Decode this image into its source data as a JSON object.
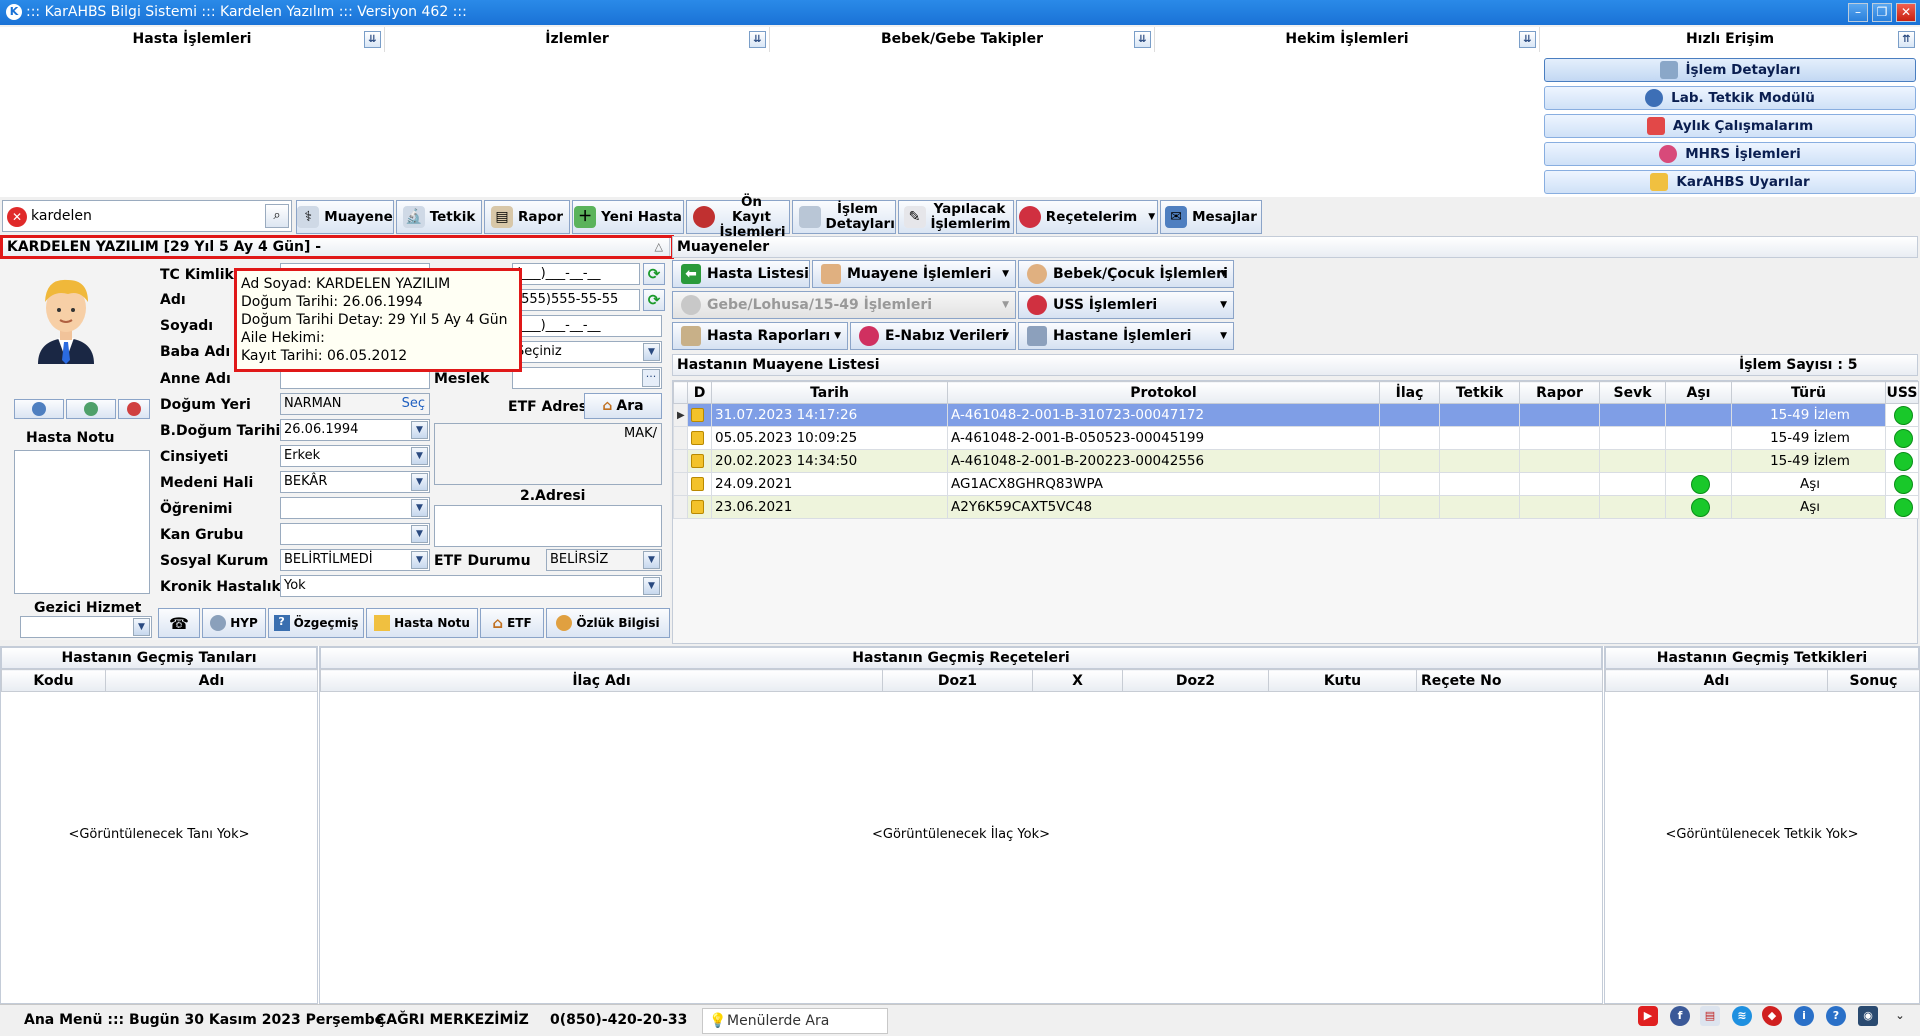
{
  "window": {
    "title": "::: KarAHBS Bilgi Sistemi ::: Kardelen Yazılım ::: Versiyon 462 :::"
  },
  "menu_headers": [
    "Hasta İşlemleri",
    "İzlemler",
    "Bebek/Gebe Takipler",
    "Hekim İşlemleri",
    "Hızlı Erişim"
  ],
  "quick_access": [
    "İşlem Detayları",
    "Lab. Tetkik Modülü",
    "Aylık Çalışmalarım",
    "MHRS İşlemleri",
    "KarAHBS Uyarılar"
  ],
  "search": {
    "value": "kardelen"
  },
  "toolbar": [
    "Muayene",
    "Tetkik",
    "Rapor",
    "Yeni Hasta",
    "Ön Kayıt İşlemleri",
    "İşlem Detayları",
    "Yapılacak İşlemlerim",
    "Reçetelerim",
    "Mesajlar"
  ],
  "patient": {
    "header": "KARDELEN YAZILIM  [29 Yıl  5 Ay  4 Gün] - ",
    "note_label": "Hasta Notu",
    "gezici_label": "Gezici Hizmet",
    "tooltip": [
      "Ad Soyad: KARDELEN YAZILIM",
      "Doğum Tarihi: 26.06.1994",
      "Doğum Tarihi Detay: 29 Yıl  5 Ay  4 Gün",
      "Aile Hekimi:",
      "Kayıt Tarihi: 06.05.2012"
    ],
    "labels": {
      "tc": "TC Kimlik N",
      "adi": "Adı",
      "soyadi": "Soyadı",
      "baba": "Baba Adı",
      "anne": "Anne Adı",
      "dogum_yeri": "Doğum Yeri",
      "b_dogum": "B.Doğum Tarihi",
      "cinsiyet": "Cinsiyeti",
      "medeni": "Medeni Hali",
      "ogrenim": "Öğrenimi",
      "kan": "Kan Grubu",
      "sosyal": "Sosyal Kurum",
      "kronik": "Kronik Hastalık",
      "meslek": "Meslek",
      "etf_adres": "ETF Adresi",
      "adres2": "2.Adresi",
      "etf_durum": "ETF Durumu"
    },
    "values": {
      "phone1": "(___)___-__-__",
      "phone2": "(555)555-55-55",
      "phone3": "(___)___-__-__",
      "meslek_select": "Seçiniz",
      "dogum_yeri": "NARMAN",
      "sec": "Seç",
      "b_dogum": "26.06.1994",
      "cinsiyet": "Erkek",
      "medeni": "BEKÂR",
      "sosyal": "BELİRTİLMEDİ",
      "kronik": "Yok",
      "etf_durum": "BELİRSİZ",
      "adres_fragment": "MAK/",
      "ara": "Ara"
    },
    "bottom_buttons": [
      "HYP",
      "Özgeçmiş",
      "Hasta Notu",
      "ETF",
      "Özlük Bilgisi"
    ]
  },
  "muayeneler": {
    "title": "Muayeneler",
    "buttons": [
      "Hasta Listesi",
      "Muayene İşlemleri",
      "Bebek/Çocuk İşlemleri",
      "Gebe/Lohusa/15-49 İşlemleri",
      "USS İşlemleri",
      "Hasta Raporları",
      "E-Nabız Verileri",
      "Hastane İşlemleri"
    ],
    "list_title": "Hastanın Muayene Listesi",
    "count": "İşlem Sayısı : 5",
    "columns": [
      "D",
      "Tarih",
      "Protokol",
      "İlaç",
      "Tetkik",
      "Rapor",
      "Sevk",
      "Aşı",
      "Türü",
      "USS"
    ],
    "rows": [
      {
        "tarih": "31.07.2023 14:17:26",
        "protokol": "A-461048-2-001-B-310723-00047172",
        "asi": false,
        "turu": "15-49 İzlem",
        "uss": true
      },
      {
        "tarih": "05.05.2023 10:09:25",
        "protokol": "A-461048-2-001-B-050523-00045199",
        "asi": false,
        "turu": "15-49 İzlem",
        "uss": true
      },
      {
        "tarih": "20.02.2023 14:34:50",
        "protokol": "A-461048-2-001-B-200223-00042556",
        "asi": false,
        "turu": "15-49 İzlem",
        "uss": true
      },
      {
        "tarih": "24.09.2021",
        "protokol": "AG1ACX8GHRQ83WPA",
        "asi": true,
        "turu": "Aşı",
        "uss": true
      },
      {
        "tarih": "23.06.2021",
        "protokol": "A2Y6K59CAXT5VC48",
        "asi": true,
        "turu": "Aşı",
        "uss": true
      }
    ]
  },
  "bottom": {
    "tanilar": {
      "title": "Hastanın Geçmiş Tanıları",
      "columns": [
        "Kodu",
        "Adı"
      ],
      "empty": "<Görüntülenecek Tanı Yok>"
    },
    "receteler": {
      "title": "Hastanın Geçmiş Reçeteleri",
      "columns": [
        "İlaç Adı",
        "Doz1",
        "X",
        "Doz2",
        "Kutu",
        "Reçete No"
      ],
      "empty": "<Görüntülenecek İlaç Yok>"
    },
    "tetkikler": {
      "title": "Hastanın Geçmiş Tetkikleri",
      "columns": [
        "Adı",
        "Sonuç"
      ],
      "empty": "<Görüntülenecek Tetkik Yok>"
    }
  },
  "statusbar": {
    "menu": "Ana Menü ::: Bugün 30 Kasım 2023 Perşembe",
    "cagri": "ÇAĞRI MERKEZİMİZ",
    "phone": "0(850)-420-20-33",
    "search_placeholder": "Menülerde Ara"
  },
  "colors": {
    "selected_row": "#7f9ee6",
    "highlight_border": "#e01818",
    "title_blue": "#1a72d6",
    "green_dot": "#19c82a"
  }
}
